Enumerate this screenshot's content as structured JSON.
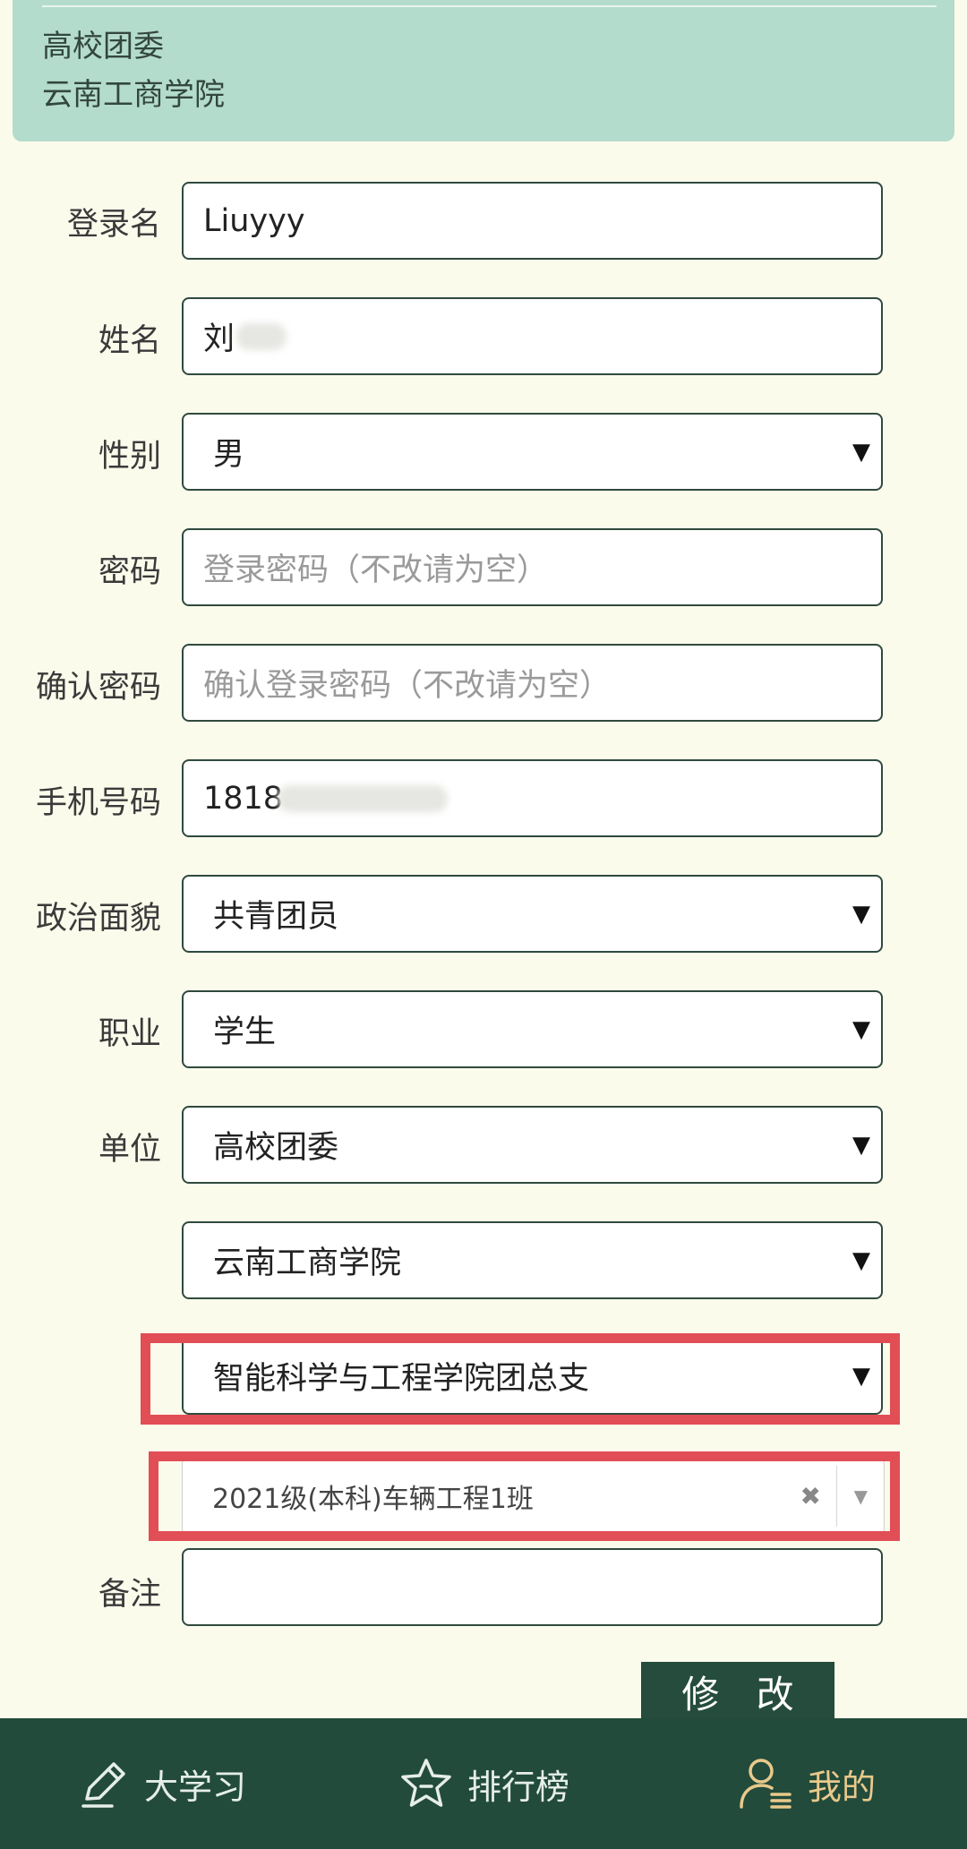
{
  "header": {
    "line1": "高校团委",
    "line2": "云南工商学院"
  },
  "form": {
    "login_name": {
      "label": "登录名",
      "value": "Liuyyy"
    },
    "name": {
      "label": "姓名",
      "value": "刘"
    },
    "gender": {
      "label": "性别",
      "value": "男"
    },
    "password": {
      "label": "密码",
      "placeholder": "登录密码（不改请为空）"
    },
    "confirm_password": {
      "label": "确认密码",
      "placeholder": "确认登录密码（不改请为空）"
    },
    "phone": {
      "label": "手机号码",
      "value": "1818"
    },
    "political_status": {
      "label": "政治面貌",
      "value": "共青团员"
    },
    "occupation": {
      "label": "职业",
      "value": "学生"
    },
    "unit": {
      "label": "单位",
      "level1": "高校团委",
      "level2": "云南工商学院",
      "level3": "智能科学与工程学院团总支",
      "level4": "2021级(本科)车辆工程1班"
    },
    "remarks": {
      "label": "备注",
      "value": ""
    },
    "submit_label": "修 改"
  },
  "nav": {
    "items": [
      {
        "label": "大学习",
        "icon": "pencil-icon",
        "active": false
      },
      {
        "label": "排行榜",
        "icon": "star-icon",
        "active": false
      },
      {
        "label": "我的",
        "icon": "user-icon",
        "active": true
      }
    ],
    "active_color": "#e9c98b"
  },
  "colors": {
    "header_bg": "#b4dccd",
    "highlight": "#e14e56",
    "nav_bg": "#224b3b",
    "page_bg": "#fbfbec"
  }
}
